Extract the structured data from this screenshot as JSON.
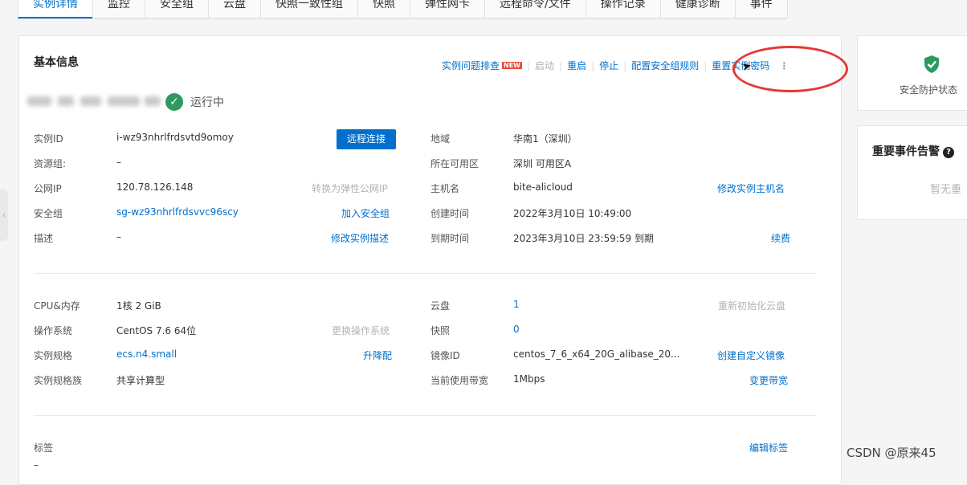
{
  "tabs": [
    {
      "label": "实例详情",
      "active": true
    },
    {
      "label": "监控",
      "active": false
    },
    {
      "label": "安全组",
      "active": false
    },
    {
      "label": "云盘",
      "active": false
    },
    {
      "label": "快照一致性组",
      "active": false
    },
    {
      "label": "快照",
      "active": false
    },
    {
      "label": "弹性网卡",
      "active": false
    },
    {
      "label": "远程命令/文件",
      "active": false
    },
    {
      "label": "操作记录",
      "active": false
    },
    {
      "label": "健康诊断",
      "active": false
    },
    {
      "label": "事件",
      "active": false
    }
  ],
  "basic": {
    "title": "基本信息",
    "actions": {
      "troubleshoot": "实例问题排查",
      "new_badge": "NEW",
      "start": "启动",
      "restart": "重启",
      "stop": "停止",
      "config_sg_rules": "配置安全组规则",
      "reset_password": "重置实例密码",
      "more": "⋮"
    },
    "status": "运行中",
    "connect_button": "远程连接",
    "left_rows": [
      {
        "label": "实例ID",
        "value": "i-wz93nhrlfrdsvtd9omoy"
      },
      {
        "label": "资源组:",
        "value": "–"
      },
      {
        "label": "公网IP",
        "value": "120.78.126.148",
        "action": "转换为弹性公网IP"
      },
      {
        "label": "安全组",
        "value": "sg-wz93nhrlfrdsvvc96scy",
        "action": "加入安全组"
      },
      {
        "label": "描述",
        "value": "–",
        "action": "修改实例描述"
      }
    ],
    "right_rows": [
      {
        "label": "地域",
        "value": "华南1（深圳）"
      },
      {
        "label": "所在可用区",
        "value": "深圳 可用区A"
      },
      {
        "label": "主机名",
        "value": "bite-alicloud",
        "action": "修改实例主机名"
      },
      {
        "label": "创建时间",
        "value": "2022年3月10日 10:49:00"
      },
      {
        "label": "到期时间",
        "value": "2023年3月10日 23:59:59 到期",
        "action": "续费"
      }
    ]
  },
  "config": {
    "left_rows": [
      {
        "label": "CPU&内存",
        "value": "1核 2 GiB"
      },
      {
        "label": "操作系统",
        "value": "CentOS 7.6 64位",
        "action": "更换操作系统"
      },
      {
        "label": "实例规格",
        "value": "ecs.n4.small",
        "action": "升降配"
      },
      {
        "label": "实例规格族",
        "value": "共享计算型"
      }
    ],
    "right_rows": [
      {
        "label": "云盘",
        "value": "1",
        "action": "重新初始化云盘"
      },
      {
        "label": "快照",
        "value": "0"
      },
      {
        "label": "镜像ID",
        "value": "centos_7_6_x64_20G_alibase_20...",
        "action": "创建自定义镜像"
      },
      {
        "label": "当前使用带宽",
        "value": "1Mbps",
        "action": "变更带宽"
      }
    ]
  },
  "tags": {
    "label": "标签",
    "value": "–",
    "action": "编辑标签"
  },
  "side": {
    "security_label": "安全防护状态",
    "events_title": "重要事件告警",
    "events_empty": "暂无重"
  },
  "watermark": "CSDN @原来45",
  "colors": {
    "accent": "#0070cc",
    "status_green": "#2e9a5f",
    "annotation_red": "#e53935"
  }
}
